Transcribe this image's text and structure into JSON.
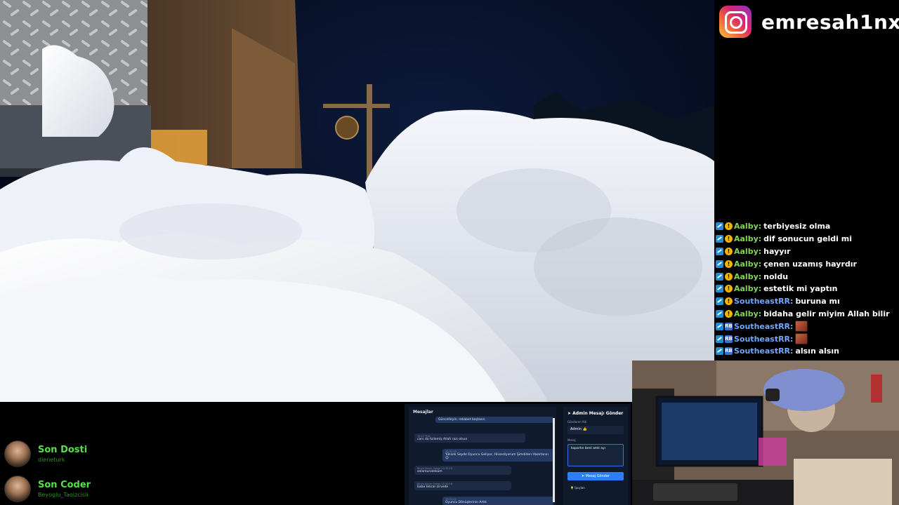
{
  "instagram": {
    "handle": "emresah1nx"
  },
  "chat": [
    {
      "user": "Aalby:",
      "text": "terbiyesiz olma",
      "color": "green",
      "badges": [
        "prime",
        "warn"
      ]
    },
    {
      "user": "Aalby:",
      "text": "dif sonucun geldi mi",
      "color": "green",
      "badges": [
        "prime",
        "warn"
      ]
    },
    {
      "user": "Aalby:",
      "text": "hayyır",
      "color": "green",
      "badges": [
        "prime",
        "warn"
      ]
    },
    {
      "user": "Aalby:",
      "text": "çenen uzamış hayrdır",
      "color": "green",
      "badges": [
        "prime",
        "warn"
      ]
    },
    {
      "user": "Aalby:",
      "text": "noldu",
      "color": "green",
      "badges": [
        "prime",
        "warn"
      ]
    },
    {
      "user": "Aalby:",
      "text": "estetik mi yaptın",
      "color": "green",
      "badges": [
        "prime",
        "warn"
      ]
    },
    {
      "user": "SoutheastRR:",
      "text": "buruna mı",
      "color": "blue",
      "badges": [
        "prime",
        "warn"
      ]
    },
    {
      "user": "Aalby:",
      "text": "bidaha gelir miyim Allah bilir",
      "color": "green",
      "badges": [
        "prime",
        "warn"
      ]
    },
    {
      "user": "SoutheastRR:",
      "text": "",
      "color": "blue",
      "badges": [
        "prime",
        "sub"
      ],
      "emote": true
    },
    {
      "user": "SoutheastRR:",
      "text": "",
      "color": "blue",
      "badges": [
        "prime",
        "sub"
      ],
      "emote": true
    },
    {
      "user": "SoutheastRR:",
      "text": "alsın alsın",
      "color": "blue",
      "badges": [
        "prime",
        "sub"
      ]
    }
  ],
  "events": {
    "last_donation": {
      "title": "Son Dosti",
      "name": "dieneturk"
    },
    "last_coder": {
      "title": "Son Coder",
      "name": "Beyoglu_Taoizcisli"
    }
  },
  "admin_panel": {
    "messages_header": "Mesajlar",
    "form_title": "Admin Mesajı Gönder",
    "sender_label": "Gönderen Adı",
    "sender_value": "Admin 👍",
    "message_label": "Mesaj",
    "message_value": "kopartın beni amk ayı",
    "send_button": "Mesaj Gönder",
    "tips_title": "İpuçları",
    "bubbles": [
      {
        "text": "Güncelleyin, rekabet başlasın.",
        "meta": ""
      },
      {
        "text": "cars da fullemiş Allah razı olsun",
        "meta": "15:27 TUG"
      },
      {
        "text": "Yüksek Seyde Oyuncu Geliyor, Hissediyorum Şimdiden Hazırlanın 😊",
        "meta": "15:31:19"
      },
      {
        "text": "selamunaleküm",
        "meta": "Birsin Adam Ovken 15:30:15"
      },
      {
        "text": "baba tekrar zirvede",
        "meta": "Birsin Adam Ovken 15:30:16"
      },
      {
        "text": "Oyuncu Dönüşlerinin Artık",
        "meta": "15:31:02"
      }
    ]
  }
}
